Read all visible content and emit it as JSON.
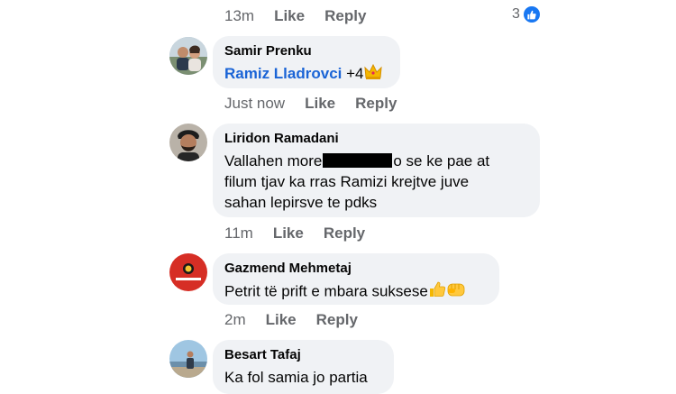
{
  "top_actions": {
    "time": "13m",
    "like": "Like",
    "reply": "Reply",
    "reaction_count": "3",
    "reaction_icon": "thumbs-up-icon"
  },
  "comments": [
    {
      "author": "Samir Prenku",
      "mention": "Ramiz Lladrovci",
      "extra": "+4",
      "emoji": "crown-emoji",
      "time": "Just now",
      "like": "Like",
      "reply": "Reply"
    },
    {
      "author": "Liridon Ramadani",
      "line1_start": "Vallahen more",
      "line1_end": "o se ke pae at",
      "line2": "filum tjav ka rras Ramizi krejtve juve",
      "line3": "sahan lepirsve te pdks",
      "time": "11m",
      "like": "Like",
      "reply": "Reply"
    },
    {
      "author": "Gazmend Mehmetaj",
      "text": "Petrit të prift e mbara suksese",
      "emojis": [
        "thumbs-up-emoji",
        "fist-emoji"
      ],
      "time": "2m",
      "like": "Like",
      "reply": "Reply"
    },
    {
      "author": "Besart Tafaj",
      "text": "Ka fol samia jo partia"
    }
  ],
  "colors": {
    "bubble": "#f0f2f5",
    "mention": "#1a64d6",
    "meta": "#65676b",
    "like_blue": "#1877f2",
    "logo_red": "#d62e25"
  }
}
